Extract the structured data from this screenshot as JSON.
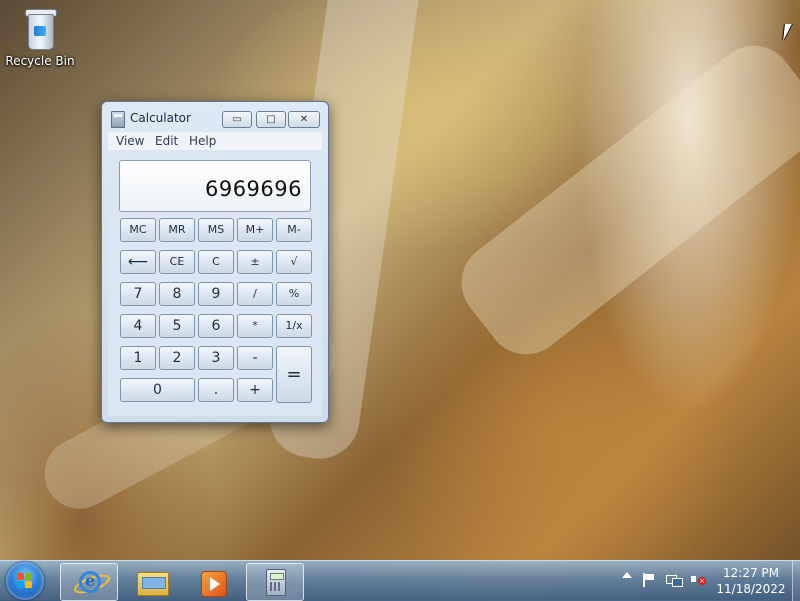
{
  "desktop": {
    "icons": [
      {
        "label": "Recycle Bin",
        "icon": "recycle-bin-icon"
      }
    ]
  },
  "calculator": {
    "title": "Calculator",
    "caption_buttons": {
      "minimize": "▭",
      "maximize": "□",
      "close": "✕"
    },
    "menu": [
      "View",
      "Edit",
      "Help"
    ],
    "display": "6969696",
    "keys": {
      "mc": "MC",
      "mr": "MR",
      "ms": "MS",
      "mplus": "M+",
      "mminus": "M-",
      "backspace": "⟵",
      "ce": "CE",
      "c": "C",
      "plusminus": "±",
      "sqrt": "√",
      "k7": "7",
      "k8": "8",
      "k9": "9",
      "divide": "/",
      "percent": "%",
      "k4": "4",
      "k5": "5",
      "k6": "6",
      "multiply": "*",
      "reciprocal": "1/x",
      "k1": "1",
      "k2": "2",
      "k3": "3",
      "minus": "-",
      "equals": "=",
      "k0": "0",
      "decimal": ".",
      "plus": "+"
    }
  },
  "taskbar": {
    "start_icon": "windows-logo-icon",
    "buttons": [
      {
        "name": "Internet Explorer",
        "icon": "internet-explorer-icon",
        "state": "pinned"
      },
      {
        "name": "Windows Explorer",
        "icon": "folder-icon",
        "state": "pinned"
      },
      {
        "name": "Windows Media Player",
        "icon": "media-player-icon",
        "state": "pinned"
      },
      {
        "name": "Calculator",
        "icon": "calculator-icon",
        "state": "active"
      }
    ],
    "tray": {
      "icons": [
        "show-hidden-icons-icon",
        "action-center-flag-icon",
        "network-icon",
        "volume-muted-icon"
      ],
      "time": "12:27 PM",
      "date": "11/18/2022"
    }
  },
  "colors": {
    "taskbar": "#5a82aa",
    "window_frame": "#cfdceb",
    "display_text": "#111111"
  }
}
